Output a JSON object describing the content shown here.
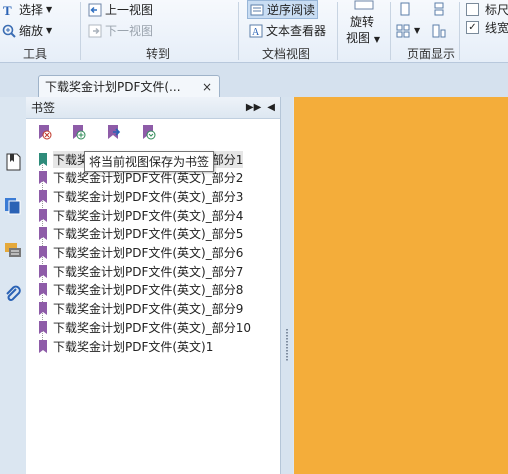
{
  "ribbon": {
    "tools_group": {
      "label": "工具",
      "select": "选择",
      "zoom": "缩放"
    },
    "goto_group": {
      "label": "转到",
      "prev_view": "上一视图",
      "next_view": "下一视图"
    },
    "docview_group": {
      "label": "文档视图",
      "reverse_read": "逆序阅读",
      "text_viewer": "文本查看器"
    },
    "rotate": {
      "line1": "旋转",
      "line2": "视图"
    },
    "pagedisplay_group": {
      "label": "页面显示"
    },
    "options": {
      "ruler": "标尺",
      "linewidth": "线宽"
    }
  },
  "tab": {
    "title": "下载奖金计划PDF文件(...",
    "close": "×"
  },
  "bookmarks": {
    "title": "书签",
    "tooltip": "将当前视图保存为书签",
    "items": [
      "下载奖金计划PDF文件(英文)_部分1",
      "下载奖金计划PDF文件(英文)_部分2",
      "下载奖金计划PDF文件(英文)_部分3",
      "下载奖金计划PDF文件(英文)_部分4",
      "下载奖金计划PDF文件(英文)_部分5",
      "下载奖金计划PDF文件(英文)_部分6",
      "下载奖金计划PDF文件(英文)_部分7",
      "下载奖金计划PDF文件(英文)_部分8",
      "下载奖金计划PDF文件(英文)_部分9",
      "下载奖金计划PDF文件(英文)_部分10",
      "下载奖金计划PDF文件(英文)1"
    ]
  },
  "colors": {
    "document_bg": "#f4ad3a",
    "bookmark_icon": "#8e5ca8",
    "bookmark_selected": "#2e8b7a"
  }
}
